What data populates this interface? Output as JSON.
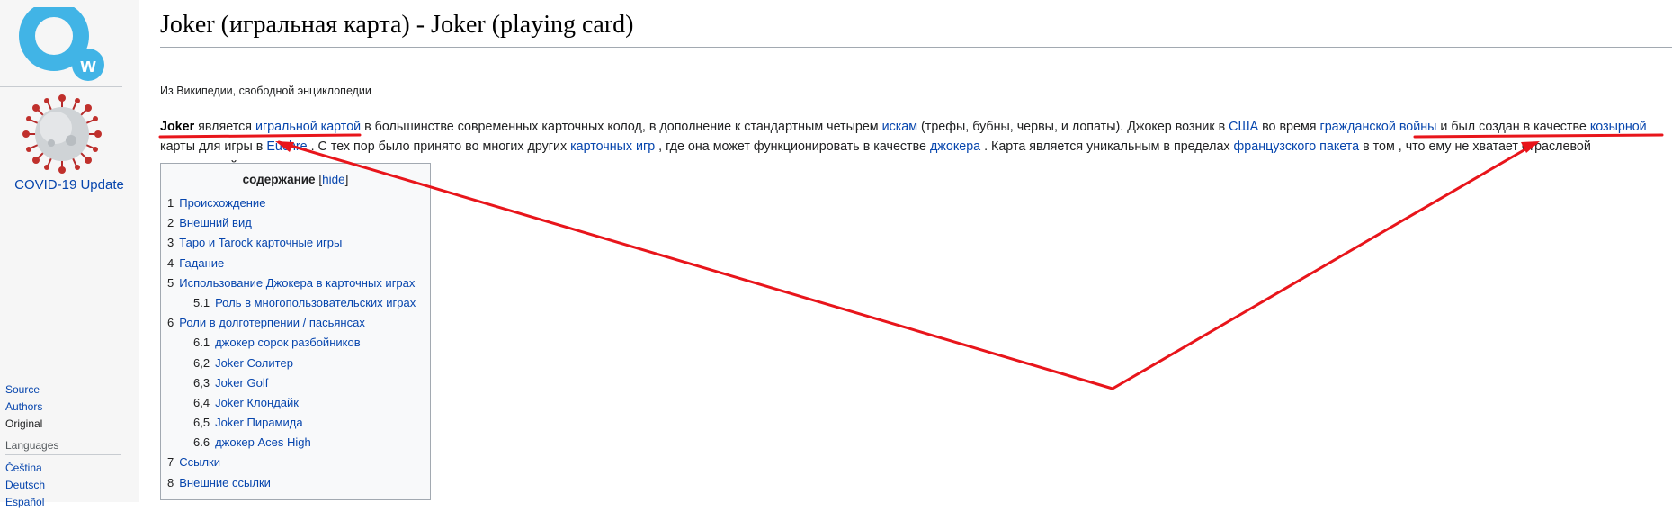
{
  "sidebar": {
    "covid_label": "COVID-19 Update",
    "links": [
      "Source",
      "Authors",
      "Original"
    ],
    "languages_heading": "Languages",
    "languages": [
      "Čeština",
      "Deutsch",
      "Español"
    ]
  },
  "article": {
    "title": "Joker (игральная карта) - Joker (playing card)",
    "tagline": "Из Википедии, свободной энциклопедии",
    "lead": {
      "s1_bold": "Joker",
      "s1_a": " является ",
      "l1": "игральной картой",
      "s1_b": " в большинстве современных карточных колод, в дополнение к стандартным четырем ",
      "l2": "искам",
      "s1_c": " (трефы, бубны, червы, и лопаты). Джокер возник в ",
      "l3": "США",
      "s1_d": " во время ",
      "l4": "гражданской войны",
      "s1_e": " и был создан в качестве ",
      "l5": "козырной",
      "s1_f": " карты для игры в ",
      "l6": "Euchre",
      "s2_a": " . С тех пор было принято во многих других ",
      "l7": "карточных игр",
      "s2_b": " , где она может функционировать в качестве ",
      "l8": "джокера",
      "s2_c": " . Карта является уникальным в пределах ",
      "l9": "французского пакета",
      "s2_d": " в том , что ему не хватает отраслевой стандартный вид."
    }
  },
  "toc": {
    "title": "содержание",
    "hide_open": " [",
    "hide_label": "hide",
    "hide_close": "]",
    "items": [
      {
        "num": "1",
        "text": "Происхождение"
      },
      {
        "num": "2",
        "text": "Внешний вид"
      },
      {
        "num": "3",
        "text": "Таро и Tarock карточные игры"
      },
      {
        "num": "4",
        "text": "Гадание"
      },
      {
        "num": "5",
        "text": "Использование Джокера в карточных играх"
      },
      {
        "num": "5.1",
        "text": "Роль в многопользовательских играх"
      },
      {
        "num": "6",
        "text": "Роли в долготерпении / пасьянсах"
      },
      {
        "num": "6.1",
        "text": "джокер сорок разбойников"
      },
      {
        "num": "6,2",
        "text": "Joker Солитер"
      },
      {
        "num": "6,3",
        "text": "Joker Golf"
      },
      {
        "num": "6,4",
        "text": "Joker Клондайк"
      },
      {
        "num": "6,5",
        "text": "Joker Пирамида"
      },
      {
        "num": "6.6",
        "text": "джокер Aces High"
      },
      {
        "num": "7",
        "text": "Ссылки"
      },
      {
        "num": "8",
        "text": "Внешние ссылки"
      }
    ]
  },
  "colors": {
    "link": "#0645ad",
    "annotation": "#e8151b",
    "logo": "#41b4e6"
  }
}
